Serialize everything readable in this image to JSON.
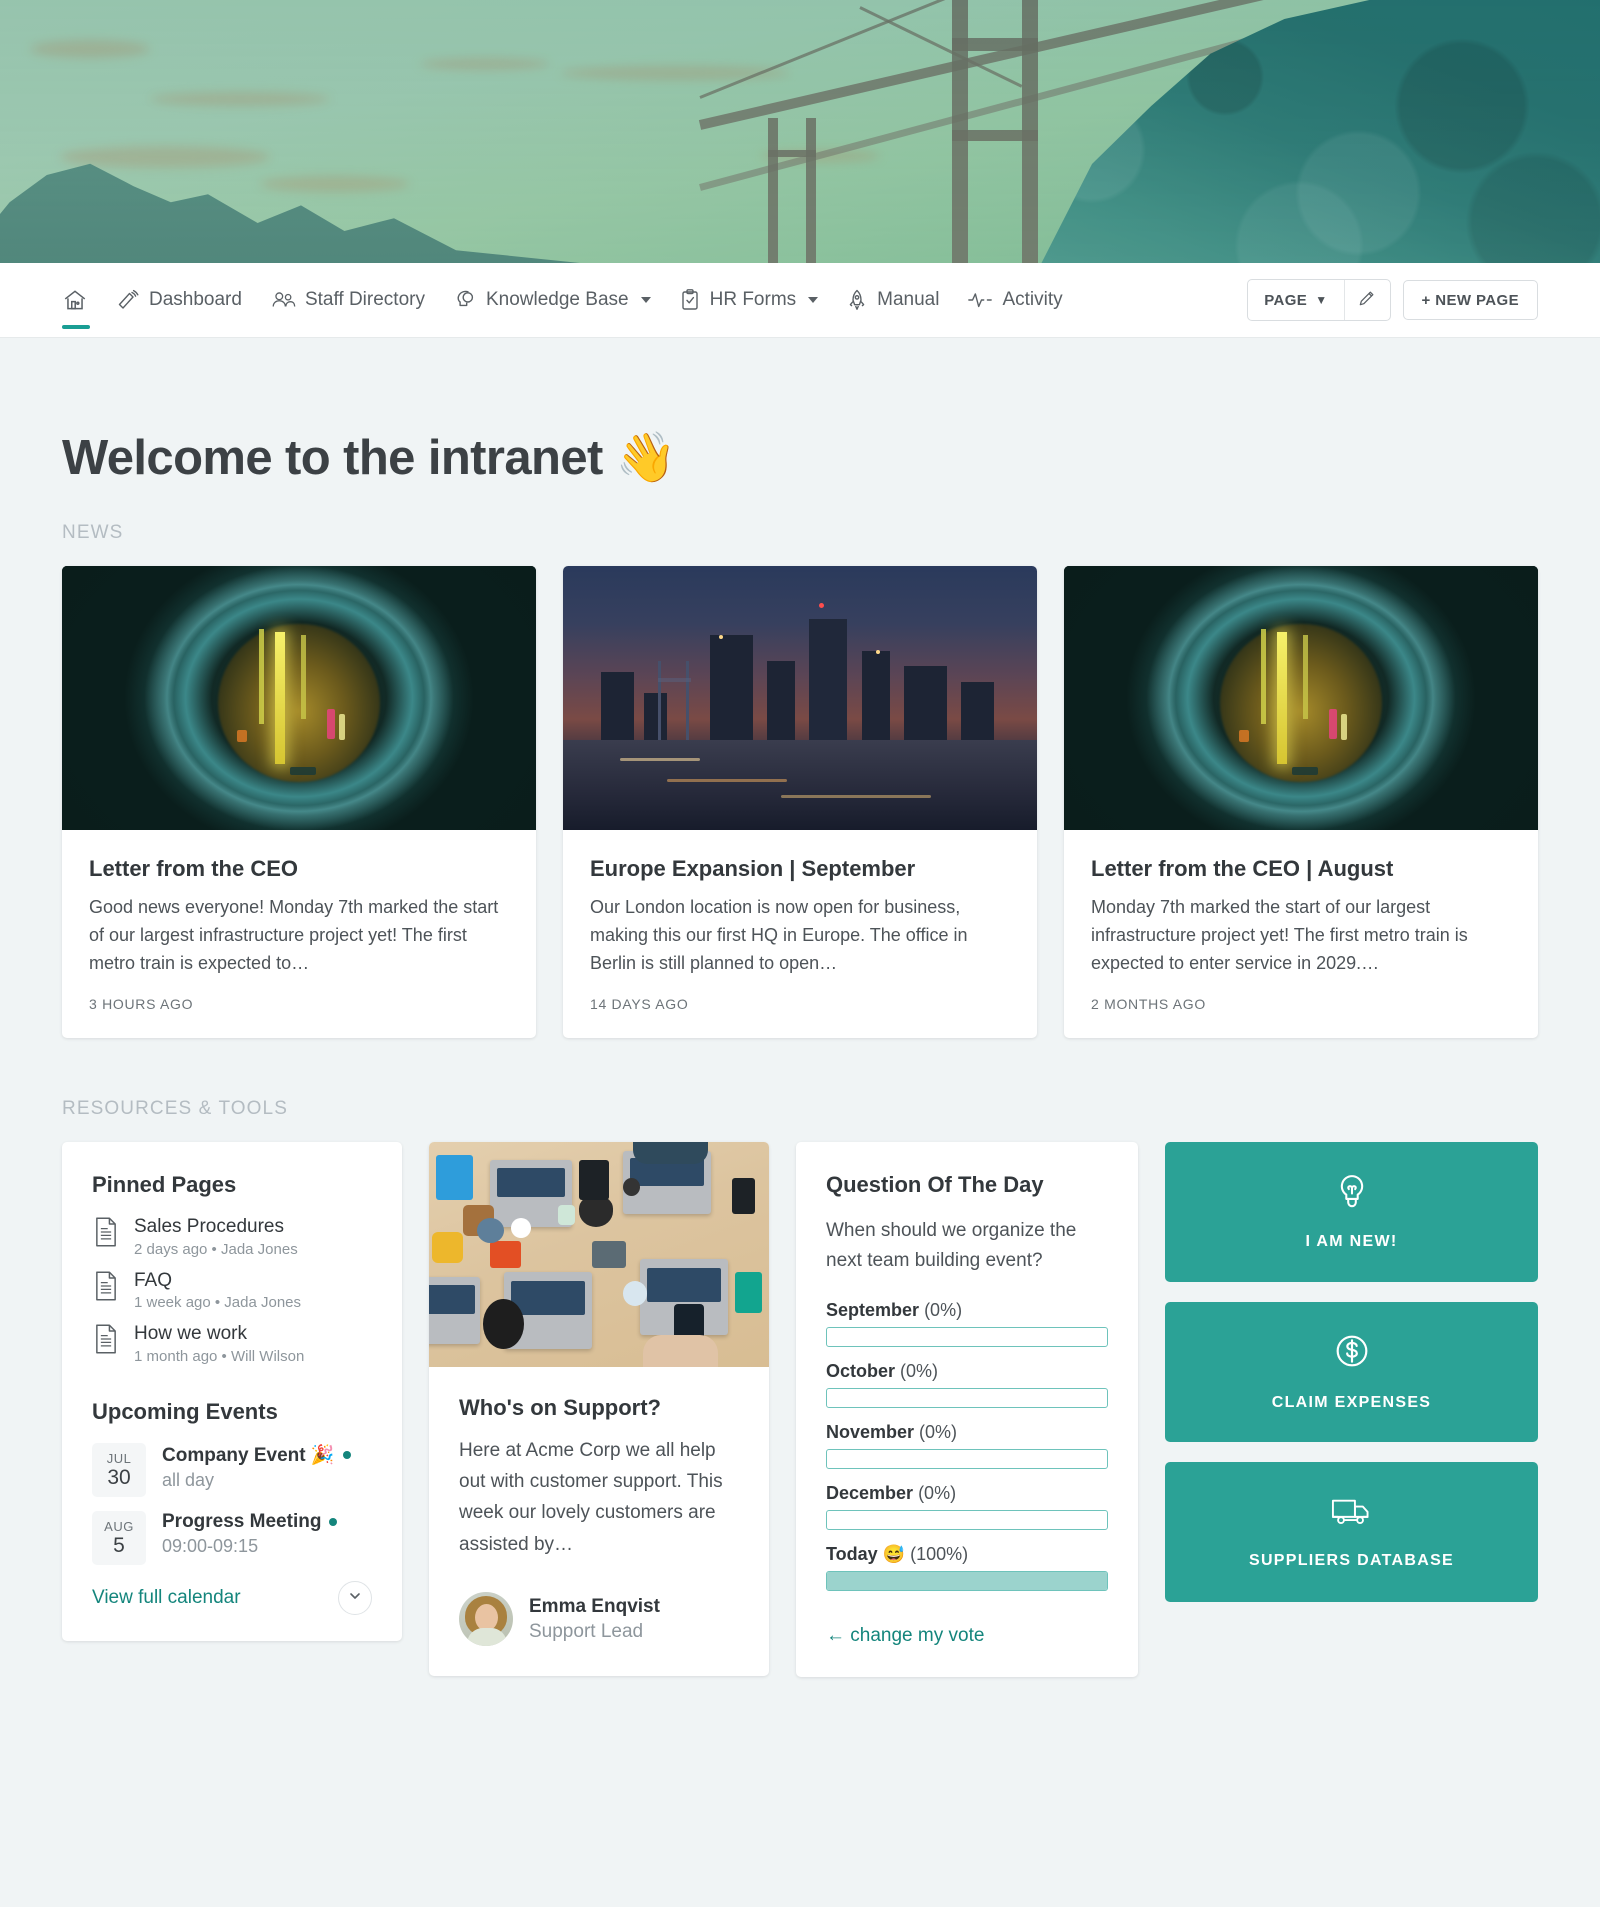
{
  "nav": {
    "items": [
      {
        "label": "",
        "icon": "home-icon",
        "active": true
      },
      {
        "label": "Dashboard",
        "icon": "megaphone-icon",
        "active": false
      },
      {
        "label": "Staff Directory",
        "icon": "people-icon",
        "active": false
      },
      {
        "label": "Knowledge Base",
        "icon": "head-idea-icon",
        "active": false,
        "dropdown": true
      },
      {
        "label": "HR Forms",
        "icon": "clipboard-check-icon",
        "active": false,
        "dropdown": true
      },
      {
        "label": "Manual",
        "icon": "rocket-icon",
        "active": false
      },
      {
        "label": "Activity",
        "icon": "pulse-icon",
        "active": false
      }
    ],
    "page_button": "PAGE",
    "page_button_caret": "▼",
    "edit_icon": "pencil-icon",
    "new_page_button": "+ NEW PAGE"
  },
  "page": {
    "title": "Welcome to the intranet 👋",
    "news_label": "NEWS",
    "resources_label": "RESOURCES & TOOLS"
  },
  "news": [
    {
      "title": "Letter from the CEO",
      "excerpt": "Good news everyone! Monday 7th marked the start of our largest infrastructure project yet! The first metro train is expected to…",
      "meta": "3 HOURS AGO",
      "image": "tunnel-construction-photo"
    },
    {
      "title": "Europe Expansion | September",
      "excerpt": "Our London location is now open for business, making this our first HQ in Europe. The office in Berlin is still planned to open…",
      "meta": "14 DAYS AGO",
      "image": "london-skyline-photo"
    },
    {
      "title": "Letter from the CEO | August",
      "excerpt": "Monday 7th marked the start of our largest infrastructure project yet! The first metro train is expected to enter service in 2029.…",
      "meta": "2 MONTHS AGO",
      "image": "tunnel-construction-photo"
    }
  ],
  "pinned": {
    "heading": "Pinned Pages",
    "items": [
      {
        "name": "Sales Procedures",
        "sub": "2 days ago • Jada Jones"
      },
      {
        "name": "FAQ",
        "sub": "1 week ago • Jada Jones"
      },
      {
        "name": "How we work",
        "sub": "1 month ago • Will Wilson"
      }
    ]
  },
  "events": {
    "heading": "Upcoming Events",
    "items": [
      {
        "month": "JUL",
        "day": "30",
        "title": "Company Event 🎉",
        "time": "all day"
      },
      {
        "month": "AUG",
        "day": "5",
        "title": "Progress Meeting",
        "time": "09:00-09:15"
      }
    ],
    "calendar_link": "View full calendar",
    "expand_icon": "chevron-down-icon"
  },
  "support": {
    "heading": "Who's on Support?",
    "text": "Here at Acme Corp we all help out with customer support. This week our lovely customers are assisted by…",
    "image": "team-desk-laptops-photo",
    "person_name": "Emma Enqvist",
    "person_role": "Support Lead"
  },
  "poll": {
    "heading": "Question Of The Day",
    "question": "When should we organize the next team building event?",
    "options": [
      {
        "label": "September",
        "percent_text": "(0%)",
        "percent": 0
      },
      {
        "label": "October",
        "percent_text": "(0%)",
        "percent": 0
      },
      {
        "label": "November",
        "percent_text": "(0%)",
        "percent": 0
      },
      {
        "label": "December",
        "percent_text": "(0%)",
        "percent": 0
      },
      {
        "label": "Today 😅",
        "percent_text": "(100%)",
        "percent": 100
      }
    ],
    "change_vote": "← change my vote"
  },
  "actions": [
    {
      "label": "I AM NEW!",
      "icon": "lightbulb-icon"
    },
    {
      "label": "CLAIM EXPENSES",
      "icon": "dollar-circle-icon"
    },
    {
      "label": "SUPPLIERS DATABASE",
      "icon": "truck-icon"
    }
  ],
  "colors": {
    "accent": "#2ba296",
    "accent_dark": "#14857c",
    "poll_fill": "#9bd3cd",
    "page_bg": "#f0f4f5",
    "text": "#33383c",
    "muted": "#8e969c"
  }
}
